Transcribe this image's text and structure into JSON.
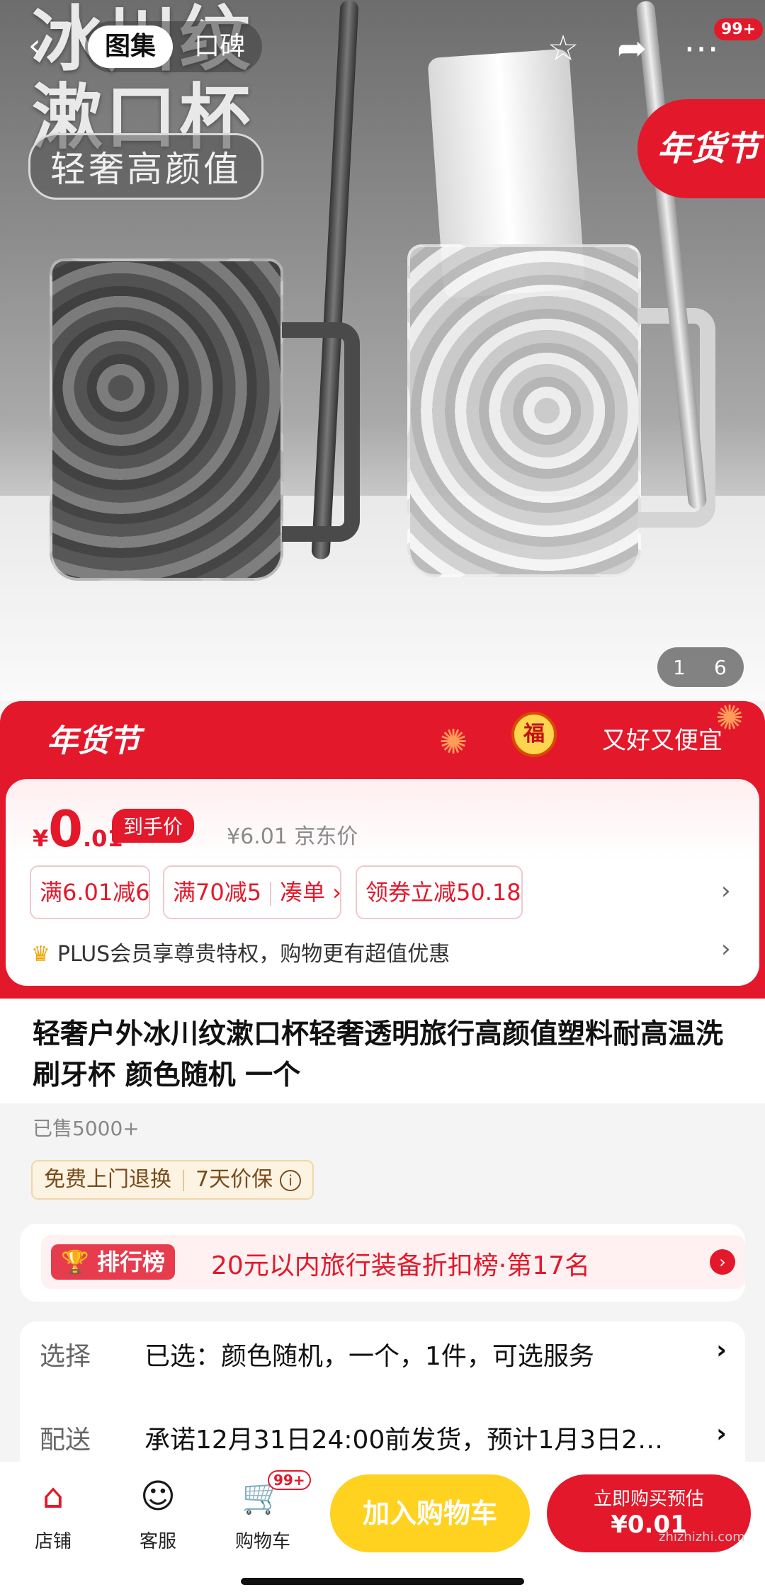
{
  "hero": {
    "promo_big_lines": [
      "冰川纹",
      "漱口杯"
    ],
    "promo_pill": "轻奢高颜值",
    "tabs": [
      "图集",
      "口碑"
    ],
    "notif_count": "99+",
    "festival_tag": "年货节",
    "pager": {
      "current": "1",
      "total": "6"
    }
  },
  "price_banner": {
    "festival_logo": "年货节",
    "lucky_icon": "福",
    "slogan": "又好又便宜",
    "currency": "¥",
    "price_int": "0",
    "price_dec": ".01",
    "arrival_tag": "到手价",
    "jd_price": "¥6.01 京东价",
    "coupons": [
      "满6.01减6",
      "满70减5",
      "凑单 ›",
      "领券立减50.18"
    ],
    "plus_text": "PLUS会员享尊贵特权，购物更有超值优惠"
  },
  "product": {
    "title": "轻奢户外冰川纹漱口杯轻奢透明旅行高颜值塑料耐高温洗刷牙杯 颜色随机 一个",
    "sold": "已售5000+",
    "service_tags": [
      "免费上门退换",
      "7天价保"
    ]
  },
  "rank": {
    "badge": "排行榜",
    "text": "20元以内旅行装备折扣榜·第17名"
  },
  "options": [
    {
      "label": "选择",
      "value": "已选：颜色随机，一个，1件，可选服务"
    },
    {
      "label": "配送",
      "value": "承诺12月31日24:00前发货，预计1月3日24:..."
    }
  ],
  "bottom_bar": {
    "shop": "店铺",
    "service": "客服",
    "cart": "购物车",
    "cart_badge": "99+",
    "add_cart": "加入购物车",
    "buy_line1": "立即购买预估",
    "buy_line2": "¥0.01"
  },
  "watermark": "zhizhizhi.com",
  "colors": {
    "accent": "#e4182b",
    "cart_button": "#ffd21f"
  }
}
